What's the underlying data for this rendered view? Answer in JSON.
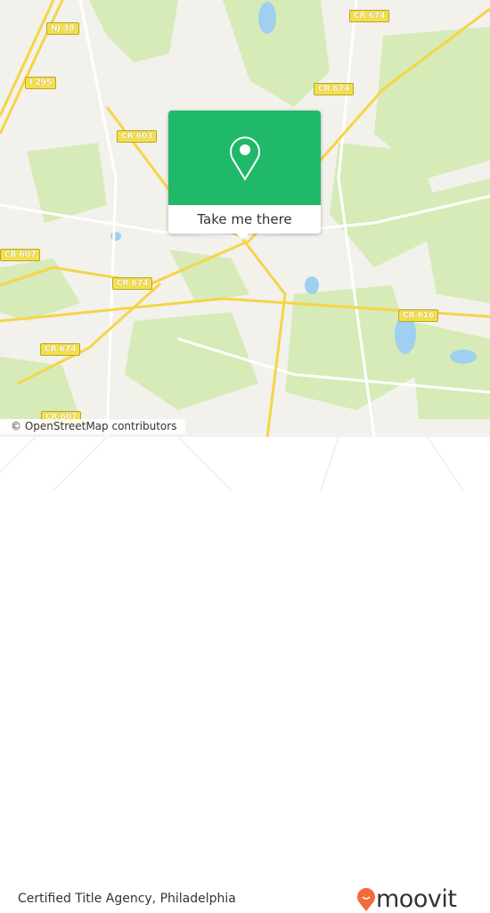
{
  "map": {
    "road_labels": [
      "NJ 38",
      "CR 674",
      "I 295",
      "CR 674",
      "CR 603",
      "CR 607",
      "CR 674",
      "CR 616",
      "CR 674",
      "CR 607"
    ],
    "attribution": "© OpenStreetMap contributors",
    "colors": {
      "background": "#f3f1ec",
      "woods": "#d6ebb8",
      "water": "#9fd0f0",
      "road": "#f5d547",
      "popup": "#20b96a"
    }
  },
  "popup": {
    "icon": "map-pin-icon",
    "button_label": "Take me there"
  },
  "footer": {
    "place_name": "Certified Title Agency, Philadelphia",
    "brand": "moovit",
    "brand_color": "#f26b3a"
  }
}
